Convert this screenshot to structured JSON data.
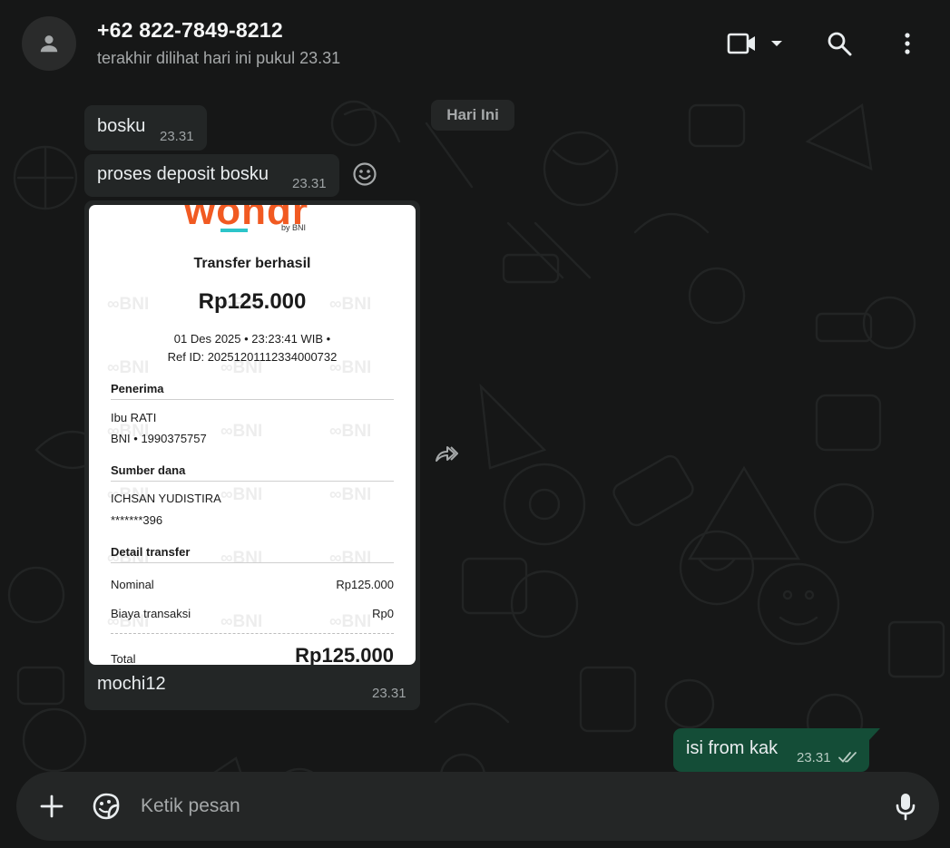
{
  "header": {
    "contact_name": "+62 822-7849-8212",
    "last_seen": "terakhir dilihat hari ini pukul 23.31",
    "icons": [
      "person-avatar-icon",
      "video-call-icon",
      "chevron-down-icon",
      "search-icon",
      "more-vertical-icon"
    ]
  },
  "chat": {
    "date_label": "Hari Ini",
    "messages": [
      {
        "text": "bosku",
        "time": "23.31",
        "direction": "incoming"
      },
      {
        "text": "proses deposit bosku",
        "time": "23.31",
        "direction": "incoming"
      },
      {
        "text": "mochi12",
        "time": "23.31",
        "direction": "incoming",
        "has_image": true
      },
      {
        "text": "isi from kak",
        "time": "23.31",
        "direction": "outgoing",
        "status": "read"
      }
    ],
    "receipt": {
      "logo": "wondr",
      "logo_sub": "by BNI",
      "title": "Transfer berhasil",
      "amount": "Rp125.000",
      "datetime": "01 Des 2025 • 23:23:41 WIB •",
      "ref": "Ref ID: 20251201112334000732",
      "recipient_heading": "Penerima",
      "recipient_name": "Ibu RATI",
      "recipient_account": "BNI • 1990375757",
      "source_heading": "Sumber dana",
      "source_name": "ICHSAN YUDISTIRA",
      "source_account": "*******396",
      "detail_heading": "Detail transfer",
      "nominal_label": "Nominal",
      "nominal_value": "Rp125.000",
      "fee_label": "Biaya transaksi",
      "fee_value": "Rp0",
      "total_label": "Total",
      "total_value": "Rp125.000",
      "watermark": "BNI"
    }
  },
  "composer": {
    "placeholder": "Ketik pesan",
    "icons": [
      "plus-icon",
      "sticker-icon",
      "microphone-icon"
    ]
  },
  "colors": {
    "background": "#161717",
    "incoming_bubble": "#232626",
    "outgoing_bubble": "#144d37",
    "read_tick": "#53bdeb",
    "logo_orange": "#f15a22",
    "logo_teal": "#2cc5c9"
  }
}
